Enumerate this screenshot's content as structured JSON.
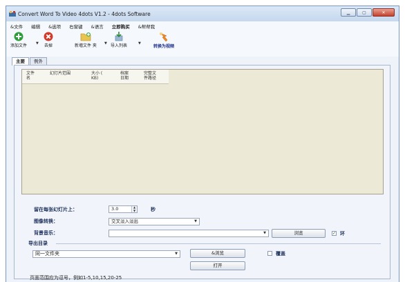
{
  "window": {
    "title": "Convert Word To Video 4dots V1.2 - 4dots Software"
  },
  "menu": [
    {
      "label": "&文件",
      "bold": false
    },
    {
      "label": "编辑",
      "bold": false
    },
    {
      "label": "&选项",
      "bold": false
    },
    {
      "label": "右窗键",
      "bold": false
    },
    {
      "label": "&语言",
      "bold": false
    },
    {
      "label": "立即购买",
      "bold": true
    },
    {
      "label": "&帮帮我",
      "bold": false
    }
  ],
  "toolbar": {
    "add_file": "添加文件",
    "remove": "去掉",
    "new_folder": "新増文件 夹",
    "import_list": "导入列表",
    "convert": "转换为视频"
  },
  "tabs": [
    {
      "label": "主要",
      "active": true
    },
    {
      "label": "例外",
      "active": false
    }
  ],
  "list": {
    "columns": [
      "文件\n名",
      "幻灯片范围",
      "大小 (\nKB)",
      "档案\n日期",
      "完整文\n件路径"
    ]
  },
  "settings": {
    "slide_duration_label": "留在每张幻灯片上：",
    "slide_duration_value": "3.0",
    "slide_duration_unit": "秒",
    "transition_label": "图像转换：",
    "transition_value": "交叉淡入淡出",
    "music_label": "背景音乐：",
    "music_value": "",
    "browse_label": "浏览",
    "loop_label": "环",
    "loop_checked": true,
    "output_group": "导出目录",
    "output_value": "同一文件夹",
    "output_browse": "&浏览",
    "overwrite_label": "覆盖",
    "overwrite_checked": false,
    "open_label": "打开",
    "hint": "页面范围应为逗号，例如1-5,10,15,20-25"
  }
}
